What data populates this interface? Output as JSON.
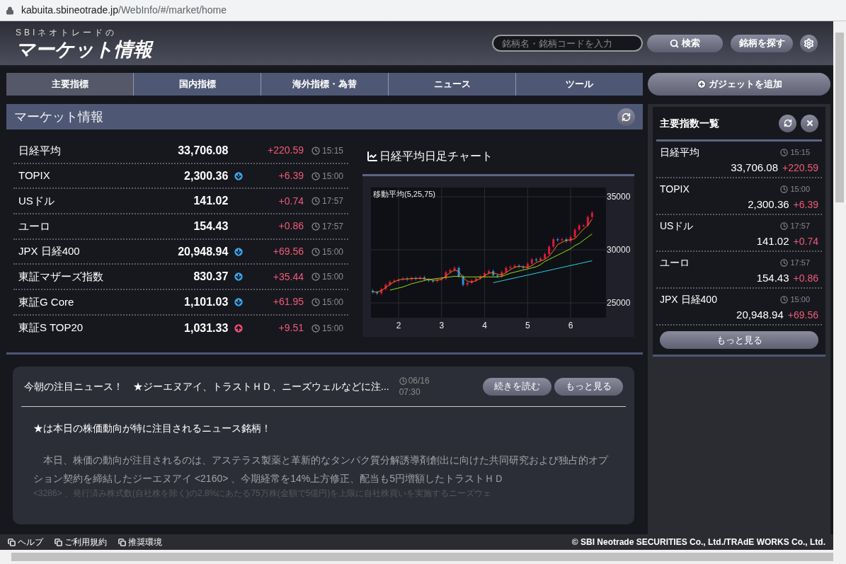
{
  "browser": {
    "url_host": "kabuita.sbineotrade.jp",
    "url_path": "/WebInfo/#/market/home"
  },
  "header": {
    "logo_small": "SBIネオトレードの",
    "logo_big": "マーケット情報",
    "search_placeholder": "銘柄名・銘柄コードを入力",
    "search_button": "検索",
    "find_button": "銘柄を探す"
  },
  "tabs": [
    {
      "label": "主要指標",
      "selected": true
    },
    {
      "label": "国内指標",
      "selected": false
    },
    {
      "label": "海外指標・為替",
      "selected": false
    },
    {
      "label": "ニュース",
      "selected": false
    },
    {
      "label": "ツール",
      "selected": false
    }
  ],
  "add_gadget": "ガジェットを追加",
  "market": {
    "title": "マーケット情報",
    "rows": [
      {
        "name": "日経平均",
        "value": "33,706.08",
        "kind": "flat",
        "change": "+220.59",
        "time": "15:15"
      },
      {
        "name": "TOPIX",
        "value": "2,300.36",
        "kind": "down",
        "change": "+6.39",
        "time": "15:00"
      },
      {
        "name": "USドル",
        "value": "141.02",
        "kind": "flat",
        "change": "+0.74",
        "time": "17:57"
      },
      {
        "name": "ユーロ",
        "value": "154.43",
        "kind": "flat",
        "change": "+0.86",
        "time": "17:57"
      },
      {
        "name": "JPX 日経400",
        "value": "20,948.94",
        "kind": "down",
        "change": "+69.56",
        "time": "15:00"
      },
      {
        "name": "東証マザーズ指数",
        "value": "830.37",
        "kind": "down",
        "change": "+35.44",
        "time": "15:00"
      },
      {
        "name": "東証G Core",
        "value": "1,101.03",
        "kind": "down",
        "change": "+61.95",
        "time": "15:00"
      },
      {
        "name": "東証S TOP20",
        "value": "1,031.33",
        "kind": "up",
        "change": "+9.51",
        "time": "15:00"
      }
    ],
    "chart": {
      "title": "日経平均日足チャート",
      "legend": "移動平均(5,25,75)",
      "chart_data": {
        "type": "candlestick",
        "grid": true,
        "xlim": [
          1.358,
          6.823
        ],
        "ylim": [
          23600,
          35867
        ],
        "xticks": [
          2,
          3,
          4,
          5,
          6
        ],
        "yticks": [
          35000,
          30000,
          25000
        ],
        "x": [
          1.4,
          1.5,
          1.6,
          1.7,
          1.8,
          1.9,
          2.0,
          2.1,
          2.2,
          2.3,
          2.4,
          2.5,
          2.6,
          2.7,
          2.8,
          2.9,
          3.0,
          3.1,
          3.2,
          3.3,
          3.4,
          3.5,
          3.6,
          3.7,
          3.8,
          3.9,
          4.0,
          4.1,
          4.2,
          4.3,
          4.4,
          4.5,
          4.6,
          4.7,
          4.8,
          4.9,
          5.0,
          5.1,
          5.2,
          5.3,
          5.4,
          5.5,
          5.6,
          5.7,
          5.8,
          5.9,
          6.0,
          6.1,
          6.2,
          6.3,
          6.4,
          6.5
        ],
        "ohlc": [
          [
            26150,
            26300,
            25850,
            26000
          ],
          [
            26000,
            26150,
            25750,
            25900
          ],
          [
            25900,
            26450,
            25750,
            26300
          ],
          [
            26300,
            26850,
            26150,
            26700
          ],
          [
            26700,
            27150,
            26550,
            27000
          ],
          [
            27000,
            27250,
            26850,
            27100
          ],
          [
            27100,
            27350,
            26950,
            27200
          ],
          [
            27200,
            27450,
            27050,
            27300
          ],
          [
            27300,
            27450,
            27050,
            27200
          ],
          [
            27200,
            27500,
            27050,
            27350
          ],
          [
            27350,
            27500,
            27100,
            27250
          ],
          [
            27250,
            27550,
            27100,
            27400
          ],
          [
            27400,
            27550,
            27050,
            27200
          ],
          [
            27200,
            27350,
            26950,
            27100
          ],
          [
            27100,
            27250,
            26900,
            27050
          ],
          [
            27050,
            27350,
            26900,
            27200
          ],
          [
            27200,
            27450,
            27050,
            27300
          ],
          [
            27300,
            28050,
            27150,
            27900
          ],
          [
            27900,
            28250,
            27750,
            28100
          ],
          [
            28100,
            28450,
            27950,
            28300
          ],
          [
            28300,
            28450,
            27350,
            27500
          ],
          [
            27500,
            27650,
            26550,
            26700
          ],
          [
            26700,
            27050,
            26550,
            26900
          ],
          [
            26900,
            27250,
            26750,
            27100
          ],
          [
            27100,
            27450,
            26950,
            27300
          ],
          [
            27300,
            27650,
            27150,
            27500
          ],
          [
            27500,
            27950,
            27350,
            27800
          ],
          [
            27800,
            28150,
            27650,
            28000
          ],
          [
            28000,
            28150,
            27450,
            27600
          ],
          [
            27600,
            27750,
            27350,
            27500
          ],
          [
            27500,
            28050,
            27350,
            27900
          ],
          [
            27900,
            28450,
            27750,
            28300
          ],
          [
            28300,
            28550,
            28150,
            28400
          ],
          [
            28400,
            28650,
            28250,
            28500
          ],
          [
            28500,
            28650,
            28250,
            28400
          ],
          [
            28400,
            28550,
            28150,
            28300
          ],
          [
            28300,
            28850,
            28150,
            28700
          ],
          [
            28700,
            29250,
            28550,
            29100
          ],
          [
            29100,
            29250,
            28850,
            29000
          ],
          [
            29000,
            29350,
            28850,
            29200
          ],
          [
            29200,
            29750,
            29050,
            29600
          ],
          [
            29600,
            30450,
            29450,
            30300
          ],
          [
            30300,
            31150,
            30150,
            31000
          ],
          [
            31000,
            31150,
            30750,
            30900
          ],
          [
            30900,
            31150,
            30750,
            31000
          ],
          [
            31000,
            31150,
            30650,
            30800
          ],
          [
            30800,
            31350,
            30650,
            31200
          ],
          [
            31200,
            32050,
            31050,
            31900
          ],
          [
            31900,
            32450,
            31750,
            32300
          ],
          [
            32300,
            32450,
            32150,
            32300
          ],
          [
            32300,
            33250,
            32150,
            33100
          ],
          [
            33100,
            33650,
            32950,
            33500
          ]
        ]
      },
      "moving_averages": {
        "chart_data": {
          "type": "line",
          "xlim": [
            1.358,
            6.823
          ],
          "ylim": [
            23600,
            35867
          ],
          "x": [
            1.4,
            1.5,
            1.6,
            1.7,
            1.8,
            1.9,
            2.0,
            2.1,
            2.2,
            2.3,
            2.4,
            2.5,
            2.6,
            2.7,
            2.8,
            2.9,
            3.0,
            3.1,
            3.2,
            3.3,
            3.4,
            3.5,
            3.6,
            3.7,
            3.8,
            3.9,
            4.0,
            4.1,
            4.2,
            4.3,
            4.4,
            4.5,
            4.6,
            4.7,
            4.8,
            4.9,
            5.0,
            5.1,
            5.2,
            5.3,
            5.4,
            5.5,
            5.6,
            5.7,
            5.8,
            5.9,
            6.0,
            6.1,
            6.2,
            6.3,
            6.4,
            6.5
          ],
          "series": [
            {
              "color": "#f07a1a",
              "values": [
                26050,
                26000,
                26150,
                26450,
                26750,
                27000,
                27150,
                27250,
                27250,
                27300,
                27300,
                27320,
                27280,
                27200,
                27120,
                27150,
                27200,
                27550,
                27850,
                28100,
                27950,
                27400,
                27050,
                26950,
                27100,
                27300,
                27550,
                27800,
                27850,
                27700,
                27650,
                27850,
                28150,
                28350,
                28450,
                28400,
                28350,
                28500,
                28800,
                28950,
                29100,
                29400,
                29900,
                30500,
                30700,
                30900,
                30950,
                31050,
                31500,
                31950,
                32300,
                32900
              ]
            },
            {
              "color": "#8fe01a",
              "values": [
                null,
                null,
                null,
                null,
                26200,
                26300,
                26400,
                26500,
                26650,
                26800,
                26900,
                27000,
                27100,
                27200,
                27250,
                27300,
                27350,
                27400,
                27450,
                27500,
                27500,
                27450,
                27450,
                27450,
                27450,
                27450,
                27450,
                27450,
                27450,
                27450,
                27500,
                27650,
                27800,
                27900,
                28000,
                28100,
                28200,
                28300,
                28400,
                28600,
                28900,
                29100,
                29300,
                29500,
                29700,
                29900,
                30100,
                30400,
                30600,
                30900,
                31200,
                31500
              ]
            },
            {
              "color": "#26d3e8",
              "values": [
                null,
                null,
                null,
                null,
                null,
                null,
                null,
                null,
                null,
                null,
                null,
                null,
                null,
                null,
                null,
                null,
                null,
                null,
                null,
                null,
                null,
                null,
                null,
                null,
                null,
                null,
                null,
                null,
                26900,
                26990,
                27080,
                27170,
                27260,
                27350,
                27440,
                27530,
                27620,
                27710,
                27800,
                27890,
                27980,
                28070,
                28160,
                28250,
                28340,
                28430,
                28520,
                28610,
                28700,
                28790,
                28880,
                28970
              ]
            }
          ]
        }
      }
    }
  },
  "news": {
    "headline": "今朝の注目ニュース！　★ジーエヌアイ、トラストＨＤ、ニーズウェルなどに注...",
    "date": "06/16",
    "time": "07:30",
    "read_more": "続きを読む",
    "see_more": "もっと見る",
    "lead": "★は本日の株価動向が特に注目されるニュース銘柄！",
    "body": [
      "　本日、株価の動向が注目されるのは、アステラス製薬と革新的なタンパク質分解誘導剤創出に向けた共同研究および独占的オプション契約を締結したジーエヌアイ <2160> 、今期経常を14%上方修正、配当も5円増額したトラストＨＤ",
      "<3286> 、発行済み株式数(自社株を除く)の2.8%にあたる75万株(金額で5億円)を上限に自社株買いを実施するニーズウェ"
    ]
  },
  "sidebar": {
    "title": "主要指数一覧",
    "rows": [
      {
        "name": "日経平均",
        "time": "15:15",
        "value": "33,706.08",
        "change": "+220.59"
      },
      {
        "name": "TOPIX",
        "time": "15:00",
        "value": "2,300.36",
        "change": "+6.39"
      },
      {
        "name": "USドル",
        "time": "17:57",
        "value": "141.02",
        "change": "+0.74"
      },
      {
        "name": "ユーロ",
        "time": "17:57",
        "value": "154.43",
        "change": "+0.86"
      },
      {
        "name": "JPX 日経400",
        "time": "15:00",
        "value": "20,948.94",
        "change": "+69.56"
      }
    ],
    "more": "もっと見る"
  },
  "footer": {
    "links": [
      "ヘルプ",
      "ご利用規約",
      "推奨環境"
    ],
    "copyright": "© SBI Neotrade SECURITIES Co., Ltd./TRAdE WORKS Co., Ltd."
  }
}
